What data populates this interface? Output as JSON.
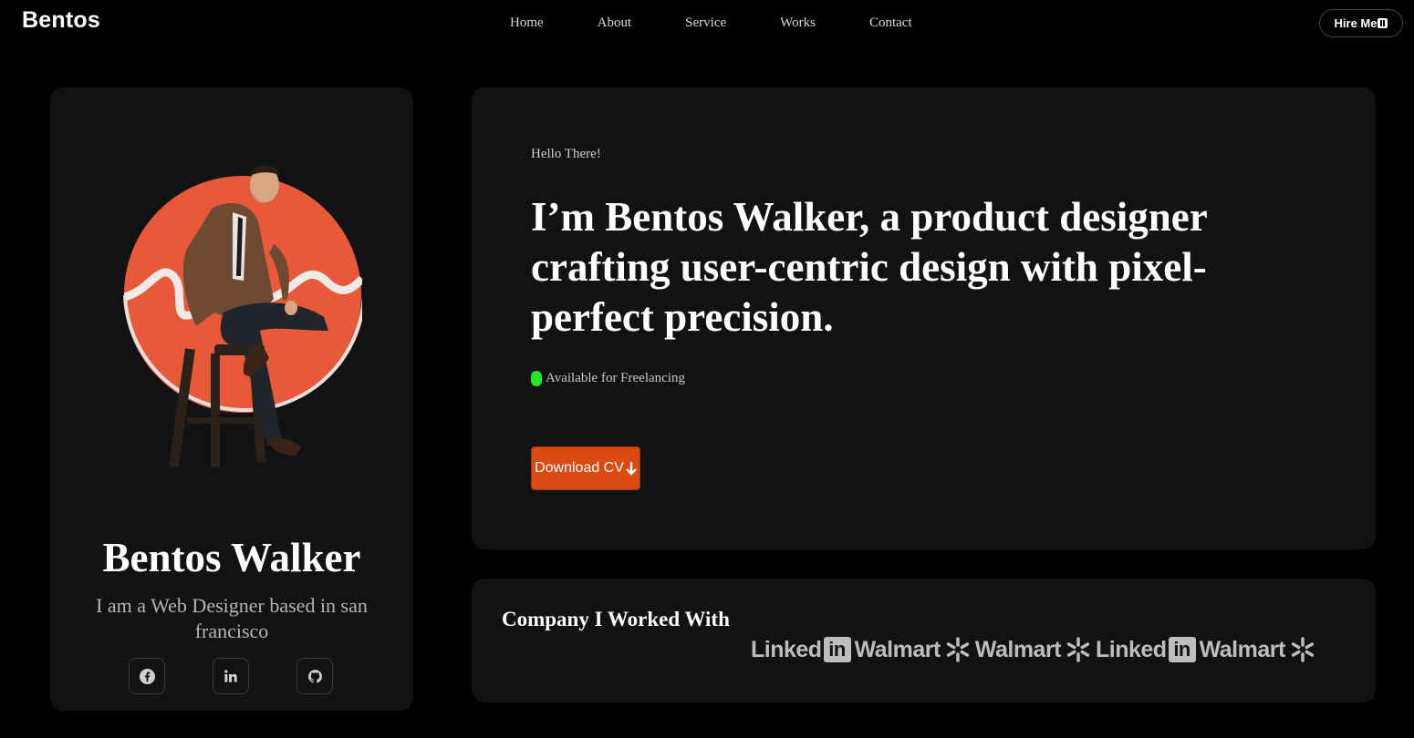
{
  "header": {
    "logo": "Bentos",
    "nav": [
      "Home",
      "About",
      "Service",
      "Works",
      "Contact"
    ],
    "hire_label": "Hire Me"
  },
  "profile": {
    "name": "Bentos Walker",
    "bio": "I am a Web Designer based in san francisco",
    "socials": [
      {
        "icon": "facebook-icon"
      },
      {
        "icon": "linkedin-icon"
      },
      {
        "icon": "github-icon"
      }
    ],
    "accent_color": "#e8593a"
  },
  "intro": {
    "greeting": "Hello There!",
    "headline": "I’m Bentos Walker, a product designer crafting user-centric design with pixel-perfect precision.",
    "status": "Available for Freelancing",
    "status_color": "#1ee82a",
    "cv_label": "Download CV",
    "cv_color": "#dc4a14"
  },
  "companies": {
    "title": "Company I Worked With",
    "logos": [
      {
        "name": "Linked",
        "badge": "in"
      },
      {
        "name": "Walmart"
      },
      {
        "name": "Walmart"
      },
      {
        "name": "Linked",
        "badge": "in"
      },
      {
        "name": "Walmart"
      }
    ]
  }
}
